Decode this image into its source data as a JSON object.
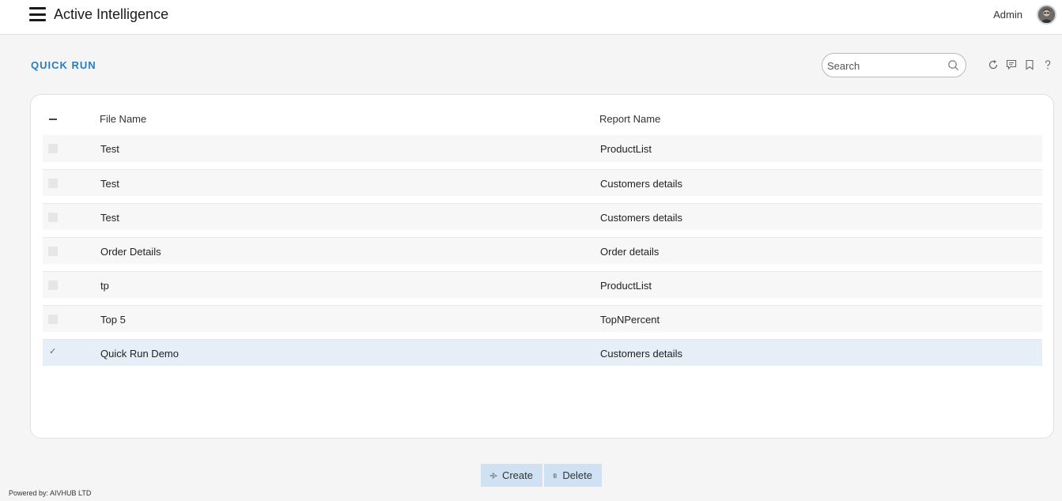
{
  "header": {
    "app_title": "Active Intelligence",
    "user_name": "Admin"
  },
  "page": {
    "title": "QUICK RUN",
    "search": {
      "placeholder": "Search",
      "value": ""
    }
  },
  "table": {
    "columns": {
      "file_name": "File Name",
      "report_name": "Report Name"
    },
    "rows": [
      {
        "file_name": "Test",
        "report_name": "ProductList",
        "selected": false
      },
      {
        "file_name": "Test",
        "report_name": "Customers details",
        "selected": false
      },
      {
        "file_name": "Test",
        "report_name": "Customers details",
        "selected": false
      },
      {
        "file_name": "Order Details",
        "report_name": "Order details",
        "selected": false
      },
      {
        "file_name": "tp",
        "report_name": "ProductList",
        "selected": false
      },
      {
        "file_name": "Top 5",
        "report_name": "TopNPercent",
        "selected": false
      },
      {
        "file_name": "Quick Run Demo",
        "report_name": "Customers details",
        "selected": true
      }
    ]
  },
  "actions": {
    "create_label": "Create",
    "delete_label": "Delete"
  },
  "footer": {
    "text": "Powered by: AIVHUB LTD"
  },
  "icons": {
    "menu": "hamburger-icon",
    "search": "search-icon",
    "refresh": "refresh-icon",
    "comment": "comment-icon",
    "bookmark": "bookmark-icon",
    "help": "help-icon",
    "create": "airplane-icon",
    "delete": "trash-icon"
  },
  "colors": {
    "accent": "#2b7bc0",
    "selected_row": "#e6eef7",
    "button_bg": "#cfe1f3"
  }
}
